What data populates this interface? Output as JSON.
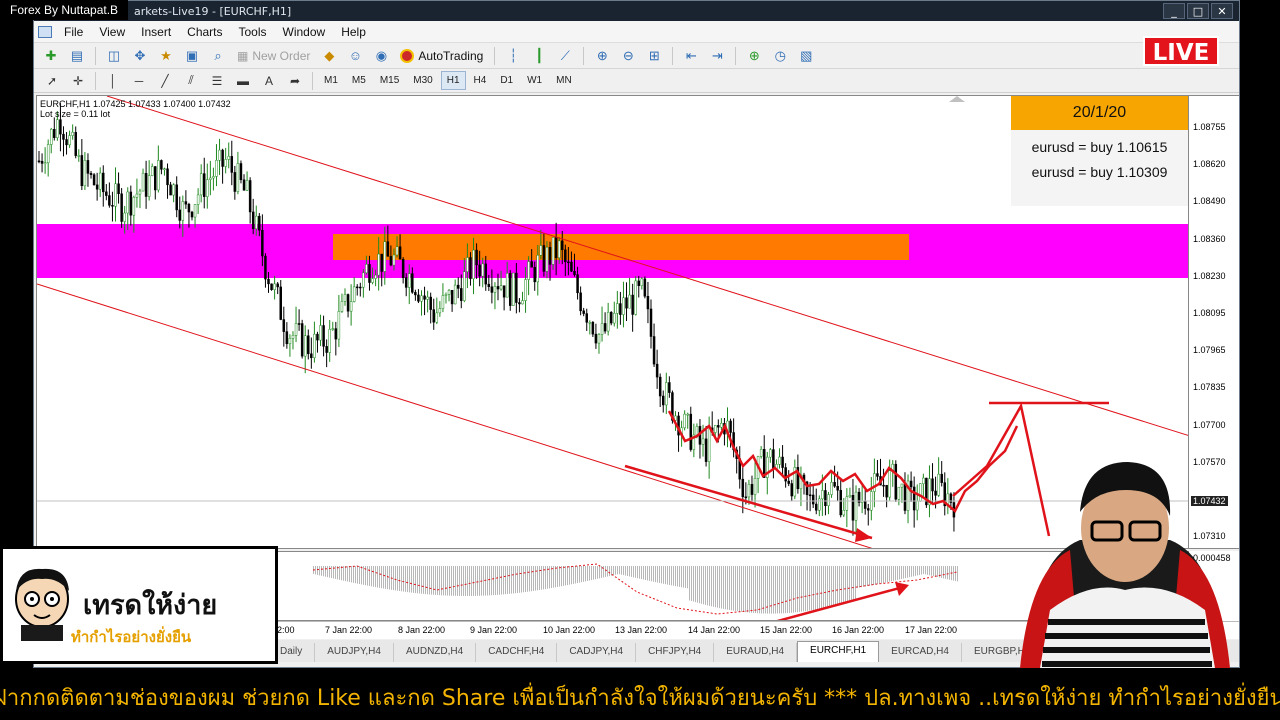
{
  "overlay": {
    "brand": "Forex By Nuttapat.B",
    "live": "LIVE",
    "note": {
      "date": "20/1/20",
      "lines": [
        "eurusd = buy 1.10615",
        "eurusd = buy 1.10309"
      ]
    },
    "logo": {
      "title": "เทรดให้ง่าย",
      "subtitle": "ทำกำไรอย่างยั่งยืน"
    },
    "ticker": "ฝากกดติดตามช่องของผม ช่วยกด Like และกด Share  เพื่อเป็นกำลังใจให้ผมด้วยนะครับ *** ปล.ทางเพจ ..เทรดให้ง่าย ทำกำไรอย่างยั่งยืน.. ไม่รับเ"
  },
  "window": {
    "title": "arkets-Live19 - [EURCHF,H1]",
    "controls": [
      "_",
      "□",
      "✕"
    ]
  },
  "menu": [
    "File",
    "View",
    "Insert",
    "Charts",
    "Tools",
    "Window",
    "Help"
  ],
  "toolbar": {
    "new_order": "New Order",
    "autotrading": "AutoTrading",
    "timeframes": [
      "M1",
      "M5",
      "M15",
      "M30",
      "H1",
      "H4",
      "D1",
      "W1",
      "MN"
    ],
    "active_timeframe": "H1"
  },
  "chart": {
    "info_line1": "EURCHF,H1  1.07425 1.07433 1.07400 1.07432",
    "info_line2": "Lot size = 0.11 lot",
    "current_price": "1.07432",
    "indicator_value": "0.000458"
  },
  "chart_data": {
    "type": "candlestick",
    "symbol": "EURCHF",
    "timeframe": "H1",
    "price_ticks": [
      "1.08755",
      "1.08620",
      "1.08490",
      "1.08360",
      "1.08230",
      "1.08095",
      "1.07965",
      "1.07835",
      "1.07700",
      "1.07570",
      "1.07432",
      "1.07310"
    ],
    "time_ticks": [
      "22:00",
      "7 Jan 22:00",
      "8 Jan 22:00",
      "9 Jan 22:00",
      "10 Jan 22:00",
      "13 Jan 22:00",
      "14 Jan 22:00",
      "15 Jan 22:00",
      "16 Jan 22:00",
      "17 Jan 22:00"
    ],
    "resistance_zone": [
      1.0822,
      1.0838
    ],
    "close_path": [
      1.0858,
      1.0873,
      1.0855,
      1.0848,
      1.0843,
      1.0849,
      1.0856,
      1.084,
      1.0851,
      1.0858,
      1.0846,
      1.082,
      1.08,
      1.0795,
      1.0798,
      1.0812,
      1.0824,
      1.0825,
      1.0818,
      1.0806,
      1.0813,
      1.0824,
      1.0818,
      1.0813,
      1.0823,
      1.0828,
      1.0812,
      1.0798,
      1.0808,
      1.0813,
      1.078,
      1.0768,
      1.076,
      1.077,
      1.0745,
      1.0758,
      1.0752,
      1.0742,
      1.0748,
      1.074,
      1.0746,
      1.075,
      1.0742,
      1.0748,
      1.0743
    ]
  },
  "tabs": [
    "Daily",
    "AUDJPY,H4",
    "AUDNZD,H4",
    "CADCHF,H4",
    "CADJPY,H4",
    "CHFJPY,H4",
    "EURAUD,H4",
    "EURCHF,H1",
    "EURCAD,H4",
    "EURGBP,H4"
  ],
  "active_tab": "EURCHF,H1",
  "colors": {
    "zone_magenta": "#ff00ff",
    "zone_orange": "#ff7a00",
    "annotation_red": "#e0121a",
    "note_header": "#f7a500"
  }
}
